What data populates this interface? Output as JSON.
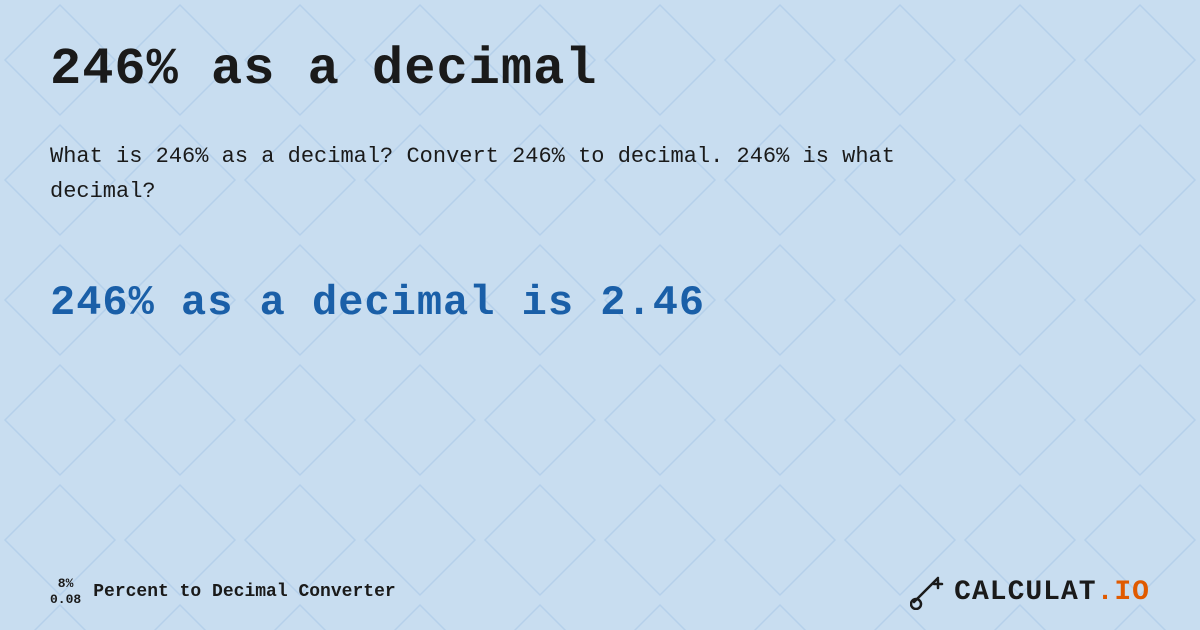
{
  "page": {
    "background_color": "#c8ddf0",
    "title": "246% as a decimal",
    "description": "What is 246% as a decimal? Convert 246% to decimal. 246% is what decimal?",
    "result": "246% as a decimal is 2.46",
    "footer": {
      "percent_top": "8%",
      "percent_bottom": "0.08",
      "label": "Percent to Decimal Converter",
      "logo_text": "CALCULAT",
      "logo_suffix": ".IO"
    }
  }
}
